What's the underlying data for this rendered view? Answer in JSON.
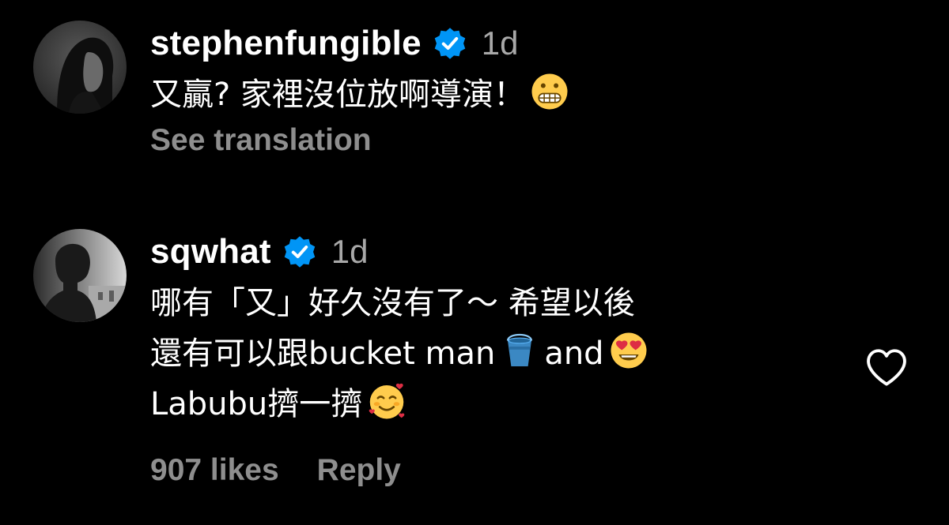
{
  "comments": [
    {
      "username": "stephenfungible",
      "verified": true,
      "time": "1d",
      "text_lines": [
        "又贏? 家裡沒位放啊導演！"
      ],
      "emoji": "grimacing-face",
      "see_translation": "See translation"
    },
    {
      "username": "sqwhat",
      "verified": true,
      "time": "1d",
      "text_line_1": "哪有「又」好久沒有了～ 希望以後",
      "text_line_2_a": "還有可以跟bucket man",
      "text_line_2_b": "and",
      "text_line_3": "Labubu擠一擠",
      "emojis": [
        "bucket",
        "heart-eyes-face",
        "smiling-face-with-hearts"
      ],
      "likes": "907 likes",
      "reply": "Reply"
    }
  ],
  "colors": {
    "background": "#000000",
    "text": "#ffffff",
    "muted": "#a8a8a8",
    "action": "#8e8e8e",
    "verified_blue": "#0095f6"
  },
  "icons": {
    "verified": "verified-badge-icon",
    "like": "heart-outline-icon"
  }
}
